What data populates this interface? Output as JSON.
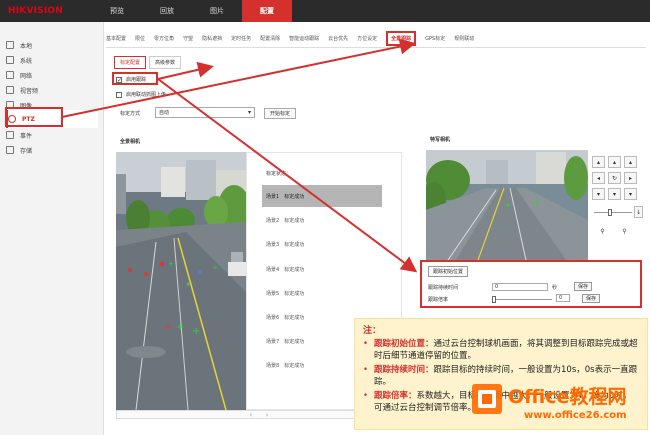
{
  "header": {
    "logo": "HIKVISION",
    "nav": [
      "预览",
      "回放",
      "图片",
      "配置"
    ],
    "active_nav": "配置"
  },
  "sidebar": {
    "items": [
      {
        "label": "本地",
        "icon": "monitor-icon"
      },
      {
        "label": "系统",
        "icon": "system-icon"
      },
      {
        "label": "网络",
        "icon": "network-icon"
      },
      {
        "label": "视音频",
        "icon": "video-icon"
      },
      {
        "label": "图像",
        "icon": "image-icon"
      },
      {
        "label": "PTZ",
        "icon": "ptz-person-icon"
      },
      {
        "label": "事件",
        "icon": "event-icon"
      },
      {
        "label": "存储",
        "icon": "storage-icon"
      }
    ]
  },
  "tabs": [
    "基本配置",
    "限位",
    "零方位角",
    "守望",
    "隐私遮挡",
    "定时任务",
    "配置清除",
    "智能运动跟踪",
    "云台优先",
    "方位设定",
    "全景跟踪",
    "GPS标定",
    "规则联动"
  ],
  "active_tab": "全景跟踪",
  "subtabs": [
    "标定配置",
    "高级参数"
  ],
  "active_subtab": "标定配置",
  "checkboxes": [
    {
      "label": "启用跟踪",
      "checked": true
    },
    {
      "label": "启用联动抓图上传",
      "checked": false
    }
  ],
  "calibration": {
    "mode_label": "标定方式",
    "mode_value": "自动",
    "start_button": "开始标定"
  },
  "panorama": {
    "title": "全景相机",
    "state_label": "标定状态：",
    "scenes": [
      {
        "name": "场景1",
        "status": "标定成功"
      },
      {
        "name": "场景2",
        "status": "标定成功"
      },
      {
        "name": "场景3",
        "status": "标定成功"
      },
      {
        "name": "场景4",
        "status": "标定成功"
      },
      {
        "name": "场景5",
        "status": "标定成功"
      },
      {
        "name": "场景6",
        "status": "标定成功"
      },
      {
        "name": "场景7",
        "status": "标定成功"
      },
      {
        "name": "场景8",
        "status": "标定成功"
      }
    ],
    "selected_scene": 0
  },
  "tracking": {
    "title": "特写相机",
    "init_button": "跟踪初始位置",
    "duration_label": "跟踪持续时间",
    "duration_value": "0",
    "duration_unit": "秒",
    "ratio_label": "跟踪倍率",
    "ratio_value": "0",
    "save_label": "保存"
  },
  "note": {
    "title": "注：",
    "items": [
      {
        "term": "跟踪初始位置：",
        "text": "通过云台控制球机画面，将其调整到目标跟踪完成或超时后细节通道停留的位置。"
      },
      {
        "term": "跟踪持续时间：",
        "text": "跟踪目标的持续时间，一般设置为10s，0s表示一直跟踪。"
      },
      {
        "term": "跟踪倍率：",
        "text": "系数越大，目标在画面中越大，一般设置为7。设为0时，可通过云台控制调节倍率。"
      }
    ]
  },
  "watermark": {
    "brand": "Office教程网",
    "url": "www.office26.com"
  },
  "colors": {
    "accent": "#d4302d",
    "topbar": "#2b2b2b",
    "note_bg": "#fef3cd",
    "watermark": "#ff6a00"
  }
}
